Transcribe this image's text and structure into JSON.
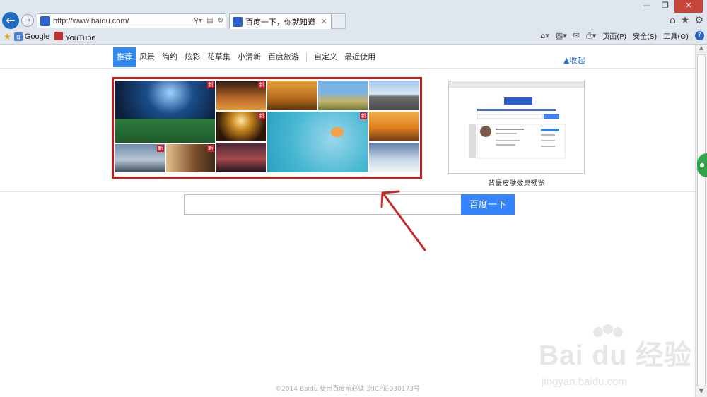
{
  "browser": {
    "url": "http://www.baidu.com/",
    "tab_title": "百度一下，你就知道",
    "favorites": [
      {
        "label": "Google"
      },
      {
        "label": "YouTube"
      }
    ],
    "commands": {
      "page": "页面(P)",
      "safety": "安全(S)",
      "tools": "工具(O)"
    }
  },
  "skin": {
    "tabs": [
      {
        "label": "推荐",
        "active": true
      },
      {
        "label": "风景"
      },
      {
        "label": "简约"
      },
      {
        "label": "炫彩"
      },
      {
        "label": "花草集"
      },
      {
        "label": "小清新"
      },
      {
        "label": "百度旅游"
      }
    ],
    "tabs_right": [
      {
        "label": "自定义"
      },
      {
        "label": "最近使用"
      }
    ],
    "collect": "收起",
    "new_badge": "新",
    "preview_caption": "背景皮肤效果预览"
  },
  "search": {
    "button": "百度一下"
  },
  "footer": "©2014  Baidu  使用百度前必读  京ICP证030173号",
  "watermark": {
    "big": "Bai du 经验",
    "small": "jingyan.baidu.com"
  },
  "colors": {
    "accent": "#3385ff",
    "highlight_border": "#c41b1b",
    "arrow": "#c42a2a"
  }
}
